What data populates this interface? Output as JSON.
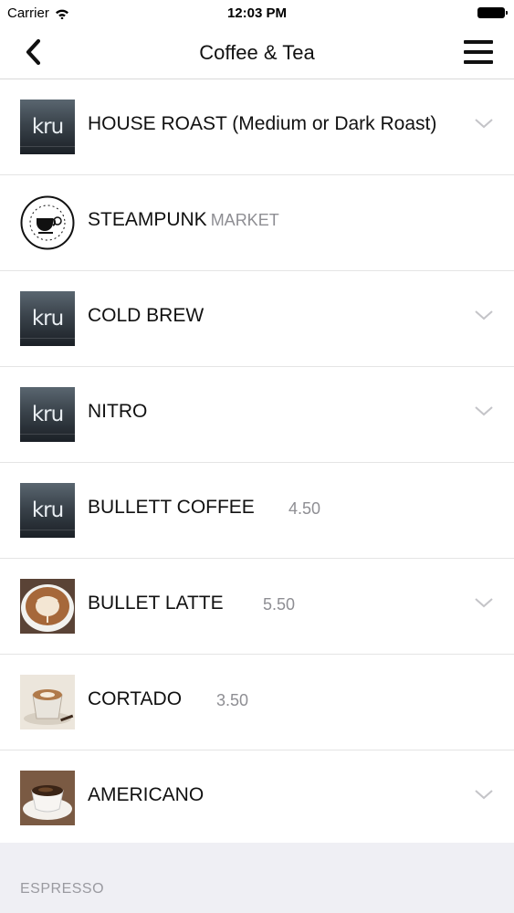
{
  "status_bar": {
    "carrier": "Carrier",
    "time": "12:03 PM"
  },
  "nav": {
    "title": "Coffee & Tea"
  },
  "items": [
    {
      "name": "HOUSE ROAST (Medium or Dark Roast)",
      "sub": "",
      "price": "",
      "thumb": "kru-logo",
      "expandable": true
    },
    {
      "name": "STEAMPUNK",
      "sub": "MARKET",
      "price": "",
      "thumb": "alpha-dominche-logo",
      "expandable": false
    },
    {
      "name": "COLD BREW",
      "sub": "",
      "price": "",
      "thumb": "kru-logo",
      "expandable": true
    },
    {
      "name": "NITRO",
      "sub": "",
      "price": "",
      "thumb": "kru-logo",
      "expandable": true
    },
    {
      "name": "BULLETT COFFEE",
      "sub": "",
      "price": "4.50",
      "thumb": "kru-logo",
      "expandable": false
    },
    {
      "name": "BULLET LATTE",
      "sub": "",
      "price": "5.50",
      "thumb": "latte-art-photo",
      "expandable": true
    },
    {
      "name": "CORTADO",
      "sub": "",
      "price": "3.50",
      "thumb": "cortado-photo",
      "expandable": false
    },
    {
      "name": "AMERICANO",
      "sub": "",
      "price": "",
      "thumb": "americano-photo",
      "expandable": true
    }
  ],
  "kru_text": "kru",
  "section_header": "ESPRESSO",
  "colors": {
    "separator": "#e4e4e4",
    "secondary_text": "#8e8e93",
    "section_bg": "#efeff4"
  }
}
